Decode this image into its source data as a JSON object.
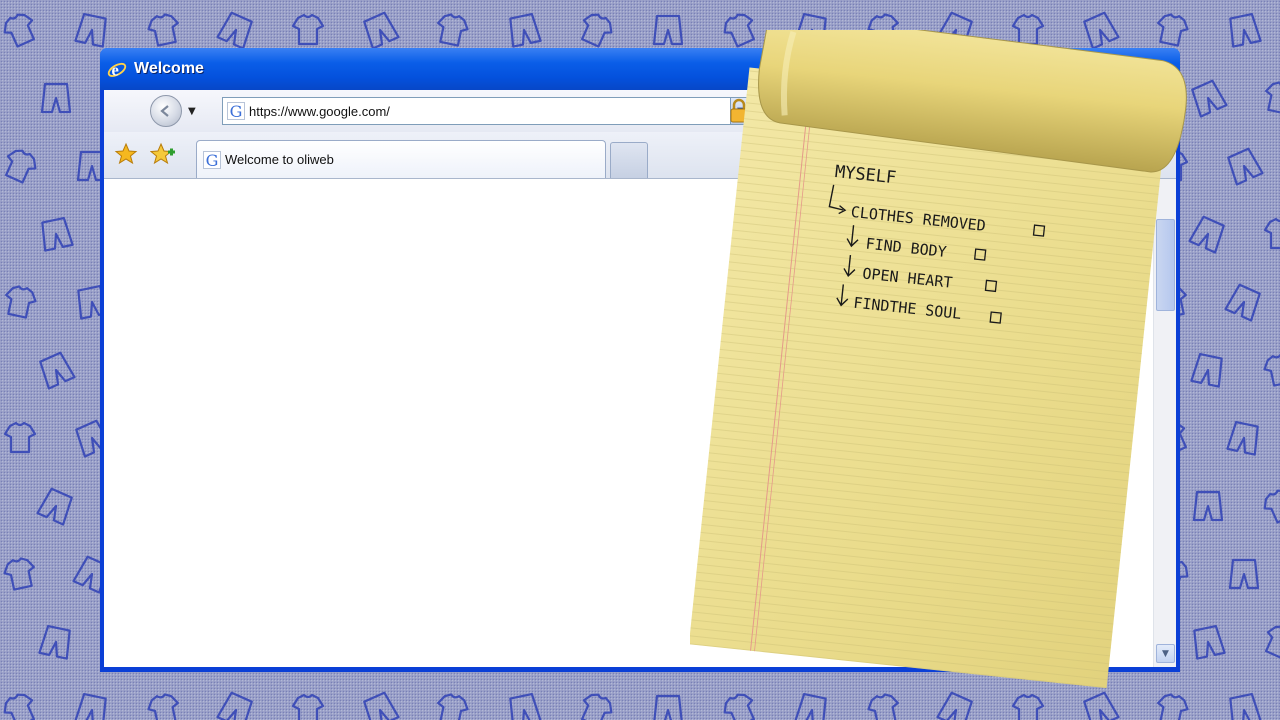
{
  "window": {
    "title": "Welcome"
  },
  "toolbar": {
    "url": "https://www.google.com/"
  },
  "tab": {
    "label": "Welcome to oliweb"
  },
  "note": {
    "heading": "MYSELF",
    "items": [
      "CLOTHES REMOVED",
      "FIND BODY",
      "OPEN HEART",
      "FINDTHE SOUL"
    ]
  },
  "colors": {
    "background": "#9aa0c8",
    "pattern": "#3f4fb8",
    "titlebar": "#0451dd",
    "paper": "#eee29a"
  },
  "icons": {
    "title": "ie-logo-icon",
    "back": "back-arrow-icon",
    "lock": "lock-icon",
    "favorites": "star-icon",
    "add_favorite": "add-favorite-icon",
    "site": "google-g-icon"
  }
}
